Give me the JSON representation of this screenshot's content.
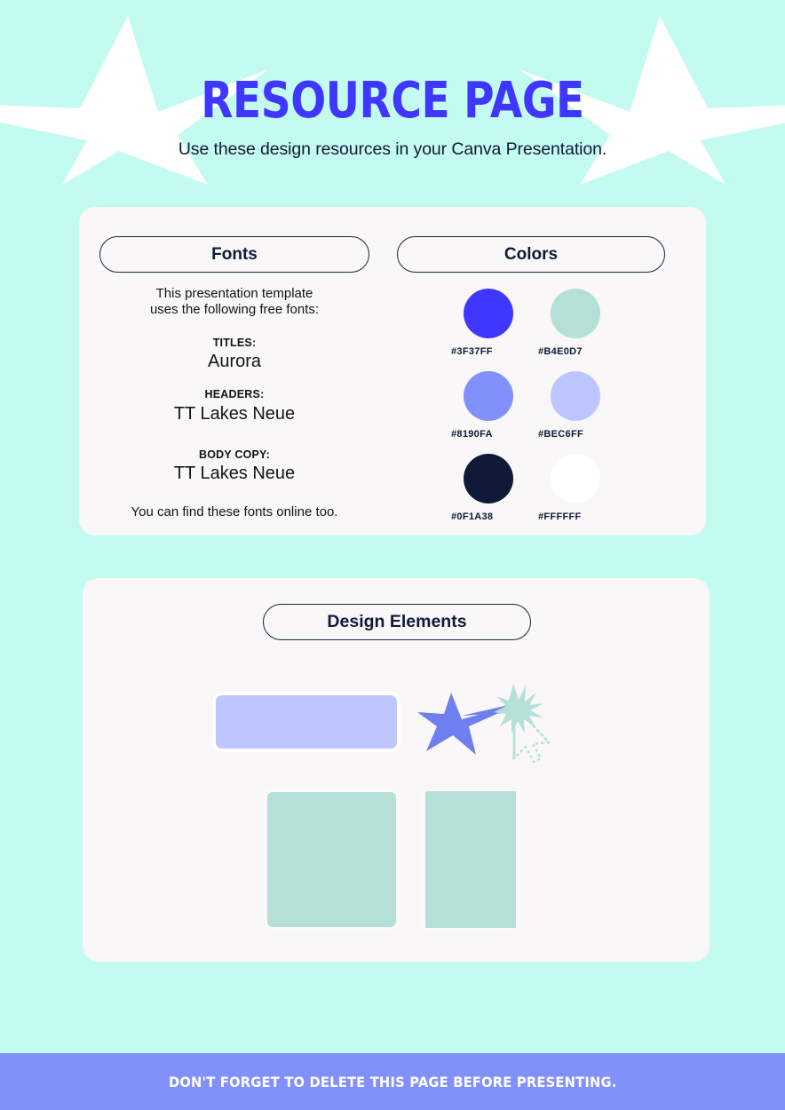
{
  "header": {
    "title": "RESOURCE PAGE",
    "subtitle": "Use these design resources in your Canva Presentation.",
    "title_color": "#3F37FF",
    "subtitle_color": "#0F1A38",
    "star_left_icon": "star-icon",
    "star_right_icon": "star-icon"
  },
  "background_color": "#C4FBF0",
  "card_color": "#F9F7F7",
  "fonts_section": {
    "heading": "Fonts",
    "intro_line_1": "This presentation template",
    "intro_line_2": "uses the following free fonts:",
    "entries": [
      {
        "role": "TITLES:",
        "name": "Aurora"
      },
      {
        "role": "HEADERS:",
        "name": "TT Lakes Neue"
      },
      {
        "role": "BODY COPY:",
        "name": "TT Lakes Neue"
      }
    ],
    "outro": "You can find these fonts online too."
  },
  "colors_section": {
    "heading": "Colors",
    "swatches": [
      {
        "hex": "#3F37FF",
        "label": "#3F37FF"
      },
      {
        "hex": "#B4E0D7",
        "label": "#B4E0D7"
      },
      {
        "hex": "#8190FA",
        "label": "#8190FA"
      },
      {
        "hex": "#BEC6FF",
        "label": "#BEC6FF"
      },
      {
        "hex": "#0F1A38",
        "label": "#0F1A38"
      },
      {
        "hex": "#FFFFFF",
        "label": "#FFFFFF"
      }
    ]
  },
  "design_section": {
    "heading": "Design Elements",
    "elements": [
      {
        "name": "rounded-rectangle",
        "fill": "#BEC6FF",
        "stroke": "#FFFFFF"
      },
      {
        "name": "shooting-star",
        "fill": "#6E7FF0",
        "sparkle_fill": "#B4E0D7",
        "cursor_stroke": "#B4E0D7"
      },
      {
        "name": "square-block",
        "fill": "#B4E0D7",
        "stroke": "#FBFAFA"
      },
      {
        "name": "portrait-block",
        "fill": "#B4E0D7",
        "stroke": "#FBFAFA"
      }
    ]
  },
  "footer": {
    "text": "DON'T FORGET TO DELETE THIS PAGE BEFORE PRESENTING.",
    "background_color": "#8190FA",
    "text_color": "#FFFFFF"
  }
}
